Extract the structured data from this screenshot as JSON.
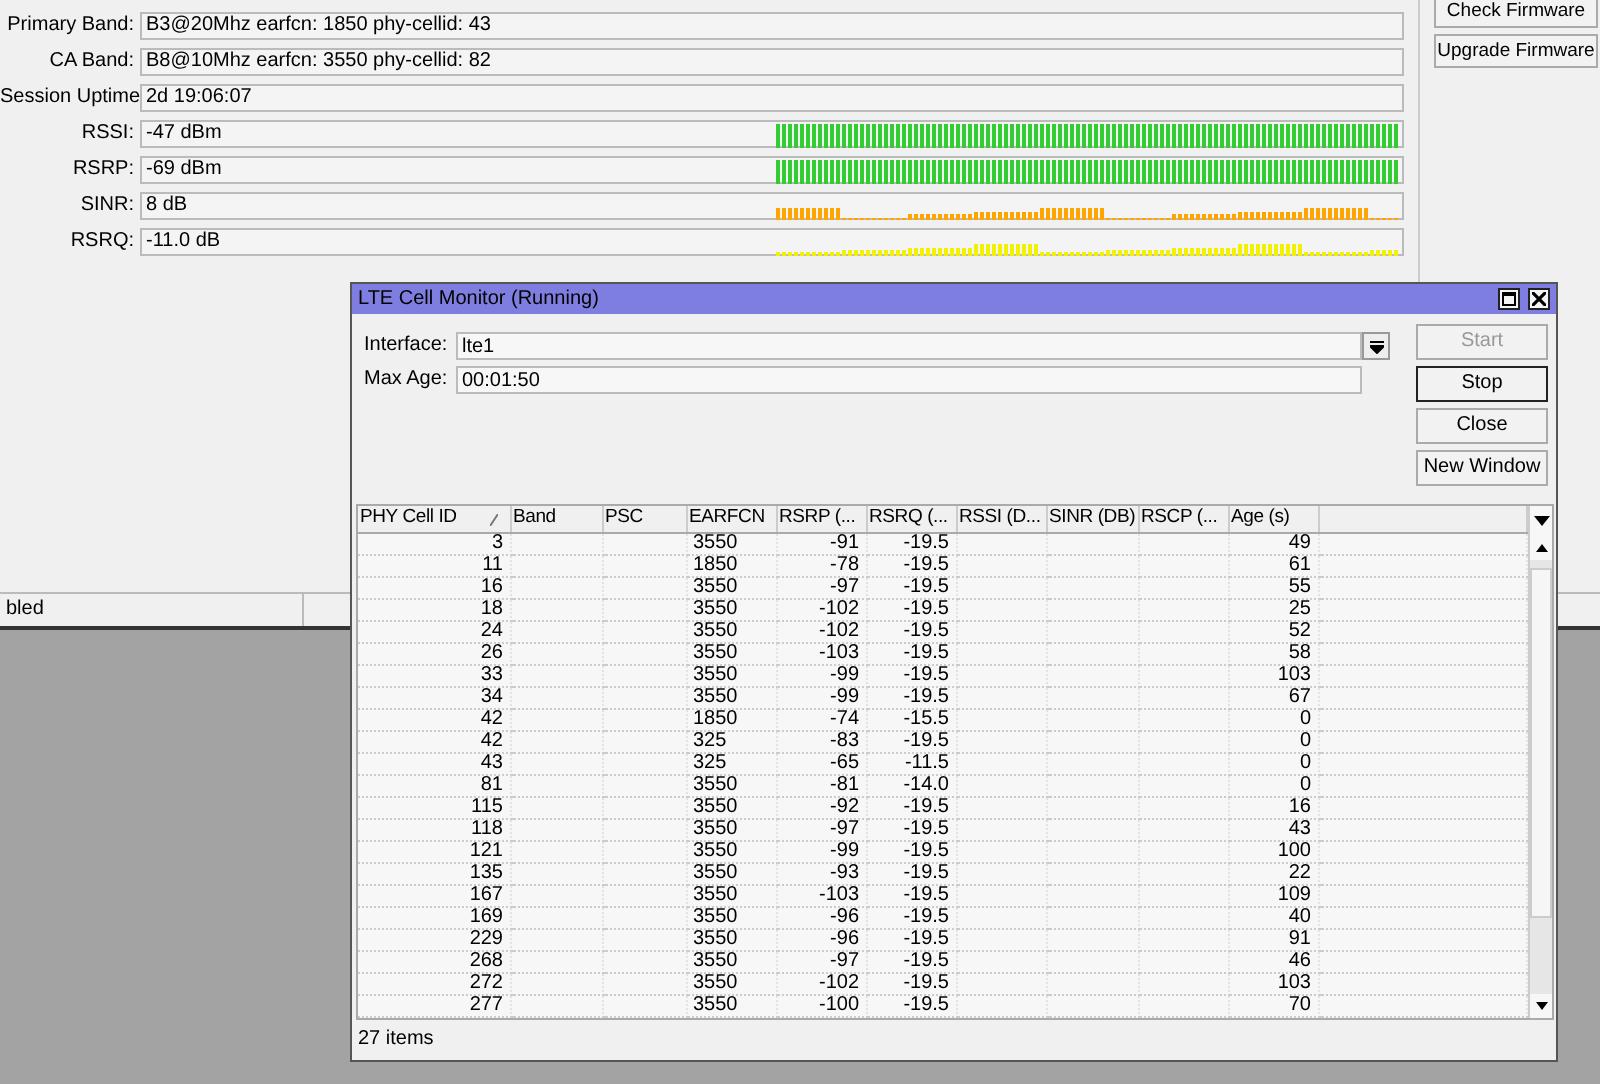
{
  "main_form": {
    "rows": [
      {
        "label": "Primary Band:",
        "value": "B3@20Mhz earfcn: 1850 phy-cellid: 43",
        "kind": "text"
      },
      {
        "label": "CA Band:",
        "value": "B8@10Mhz earfcn: 3550 phy-cellid: 82",
        "kind": "text"
      },
      {
        "label": "Session Uptime:",
        "value": "2d 19:06:07",
        "kind": "text"
      },
      {
        "label": "RSSI:",
        "value": "-47 dBm",
        "kind": "meter",
        "color": "#33cc33"
      },
      {
        "label": "RSRP:",
        "value": "-69 dBm",
        "kind": "meter",
        "color": "#33cc33"
      },
      {
        "label": "SINR:",
        "value": "8 dB",
        "kind": "meter",
        "color": "#ffa500"
      },
      {
        "label": "RSRQ:",
        "value": "-11.0 dB",
        "kind": "meter",
        "color": "#f2f200"
      }
    ]
  },
  "side_buttons": [
    "Check Firmware",
    "Upgrade Firmware"
  ],
  "status_bar": {
    "cells": [
      "bled"
    ]
  },
  "monitor": {
    "title": "LTE Cell Monitor (Running)",
    "interface": {
      "label": "Interface:",
      "value": "lte1"
    },
    "max_age": {
      "label": "Max Age:",
      "value": "00:01:50"
    },
    "buttons": [
      {
        "label": "Start",
        "disabled": true,
        "default": false
      },
      {
        "label": "Stop",
        "disabled": false,
        "default": true
      },
      {
        "label": "Close",
        "disabled": false,
        "default": false
      },
      {
        "label": "New Window",
        "disabled": false,
        "default": false
      }
    ],
    "table": {
      "columns": [
        {
          "label": "PHY Cell ID",
          "sorted": true
        },
        {
          "label": "Band",
          "sorted": false
        },
        {
          "label": "PSC",
          "sorted": false
        },
        {
          "label": "EARFCN",
          "sorted": false
        },
        {
          "label": "RSRP (...",
          "sorted": false
        },
        {
          "label": "RSRQ (...",
          "sorted": false
        },
        {
          "label": "RSSI (D...",
          "sorted": false
        },
        {
          "label": "SINR (DB)",
          "sorted": false
        },
        {
          "label": "RSCP (...",
          "sorted": false
        },
        {
          "label": "Age (s)",
          "sorted": false
        }
      ],
      "rows": [
        {
          "phy_cell_id": "3",
          "earfcn": "3550",
          "rsrp": "-91",
          "rsrq": "-19.5",
          "age": "49"
        },
        {
          "phy_cell_id": "11",
          "earfcn": "1850",
          "rsrp": "-78",
          "rsrq": "-19.5",
          "age": "61"
        },
        {
          "phy_cell_id": "16",
          "earfcn": "3550",
          "rsrp": "-97",
          "rsrq": "-19.5",
          "age": "55"
        },
        {
          "phy_cell_id": "18",
          "earfcn": "3550",
          "rsrp": "-102",
          "rsrq": "-19.5",
          "age": "25"
        },
        {
          "phy_cell_id": "24",
          "earfcn": "3550",
          "rsrp": "-102",
          "rsrq": "-19.5",
          "age": "52"
        },
        {
          "phy_cell_id": "26",
          "earfcn": "3550",
          "rsrp": "-103",
          "rsrq": "-19.5",
          "age": "58"
        },
        {
          "phy_cell_id": "33",
          "earfcn": "3550",
          "rsrp": "-99",
          "rsrq": "-19.5",
          "age": "103"
        },
        {
          "phy_cell_id": "34",
          "earfcn": "3550",
          "rsrp": "-99",
          "rsrq": "-19.5",
          "age": "67"
        },
        {
          "phy_cell_id": "42",
          "earfcn": "1850",
          "rsrp": "-74",
          "rsrq": "-15.5",
          "age": "0"
        },
        {
          "phy_cell_id": "42",
          "earfcn": "325",
          "rsrp": "-83",
          "rsrq": "-19.5",
          "age": "0"
        },
        {
          "phy_cell_id": "43",
          "earfcn": "325",
          "rsrp": "-65",
          "rsrq": "-11.5",
          "age": "0"
        },
        {
          "phy_cell_id": "81",
          "earfcn": "3550",
          "rsrp": "-81",
          "rsrq": "-14.0",
          "age": "0"
        },
        {
          "phy_cell_id": "115",
          "earfcn": "3550",
          "rsrp": "-92",
          "rsrq": "-19.5",
          "age": "16"
        },
        {
          "phy_cell_id": "118",
          "earfcn": "3550",
          "rsrp": "-97",
          "rsrq": "-19.5",
          "age": "43"
        },
        {
          "phy_cell_id": "121",
          "earfcn": "3550",
          "rsrp": "-99",
          "rsrq": "-19.5",
          "age": "100"
        },
        {
          "phy_cell_id": "135",
          "earfcn": "3550",
          "rsrp": "-93",
          "rsrq": "-19.5",
          "age": "22"
        },
        {
          "phy_cell_id": "167",
          "earfcn": "3550",
          "rsrp": "-103",
          "rsrq": "-19.5",
          "age": "109"
        },
        {
          "phy_cell_id": "169",
          "earfcn": "3550",
          "rsrp": "-96",
          "rsrq": "-19.5",
          "age": "40"
        },
        {
          "phy_cell_id": "229",
          "earfcn": "3550",
          "rsrp": "-96",
          "rsrq": "-19.5",
          "age": "91"
        },
        {
          "phy_cell_id": "268",
          "earfcn": "3550",
          "rsrp": "-97",
          "rsrq": "-19.5",
          "age": "46"
        },
        {
          "phy_cell_id": "272",
          "earfcn": "3550",
          "rsrp": "-102",
          "rsrq": "-19.5",
          "age": "103"
        },
        {
          "phy_cell_id": "277",
          "earfcn": "3550",
          "rsrp": "-100",
          "rsrq": "-19.5",
          "age": "70"
        }
      ]
    },
    "status": "27 items"
  }
}
